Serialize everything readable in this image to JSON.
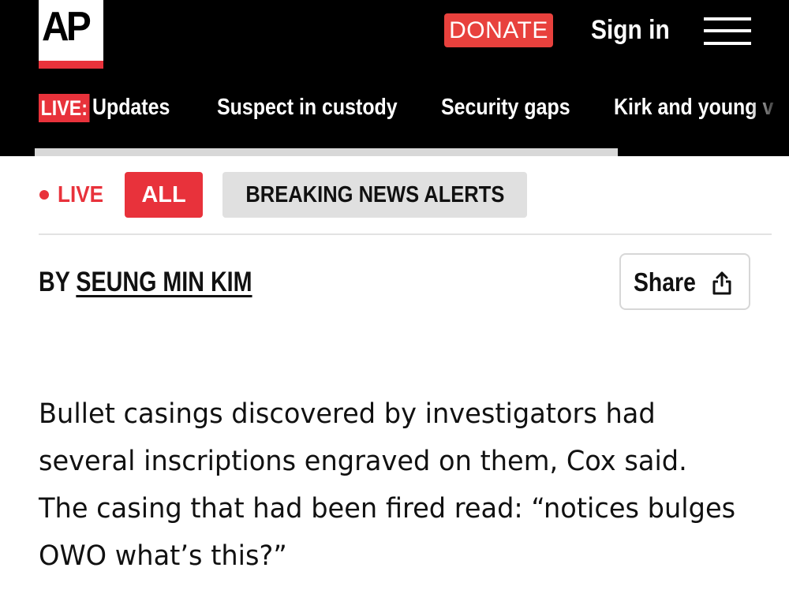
{
  "header": {
    "logo_text": "AP",
    "donate_label": "DONATE",
    "signin_label": "Sign in",
    "menu_icon": "hamburger-menu-icon"
  },
  "nav": {
    "live_badge": "LIVE:",
    "items": [
      "Updates",
      "Suspect in custody",
      "Security gaps",
      "Kirk and young v"
    ]
  },
  "filters": {
    "live_label": "LIVE",
    "tabs": [
      "ALL",
      "BREAKING NEWS ALERTS"
    ],
    "active_tab": "ALL"
  },
  "article": {
    "byline_prefix": "BY",
    "author": "SEUNG MIN KIM",
    "share_label": "Share",
    "share_icon": "share-upload-icon",
    "paragraph": "Bullet casings discovered by investigators had several inscriptions engraved on them, Cox said. The casing that had been fired read: “notices bulges OWO what’s this?”"
  },
  "colors": {
    "brand_red": "#e8323b",
    "header_bg": "#000000",
    "tab_gray": "#e0e0e0"
  }
}
